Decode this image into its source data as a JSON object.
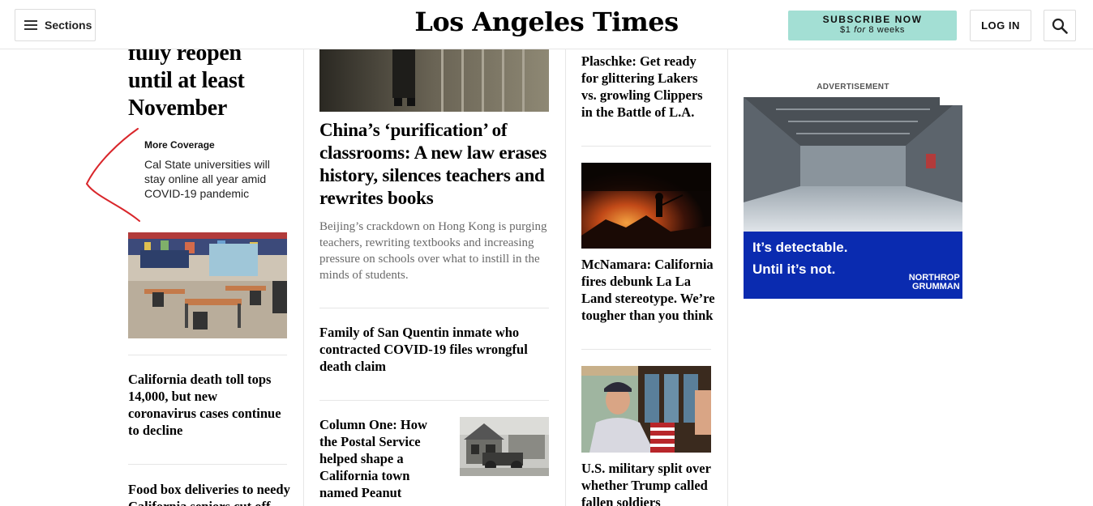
{
  "header": {
    "sections_label": "Sections",
    "logo": "Los Angeles Times",
    "subscribe_title": "SUBSCRIBE NOW",
    "subscribe_price": "$1",
    "subscribe_for": "for",
    "subscribe_period": "8 weeks",
    "login_label": "LOG IN"
  },
  "left_column": {
    "top_headline": [
      "fully reopen",
      "until at least",
      "November"
    ],
    "more_coverage_label": "More Coverage",
    "more_coverage_link": "Cal State universities will stay online all year amid COVID-19 pandemic",
    "story2_headline": "California death toll tops 14,000, but new coronavirus cases continue to decline",
    "story3_headline": "Food box deliveries to needy California seniors cut off"
  },
  "center_column": {
    "main_headline": "China’s ‘purification’ of classrooms: A new law erases history, silences teachers and rewrites books",
    "main_description": "Beijing’s crackdown on Hong Kong is purging teachers, rewriting textbooks and increasing pressure on schools over what to instill in the minds of students.",
    "story2_headline": "Family of San Quentin inmate who contracted COVID-19 files wrongful death claim",
    "story3_headline": "Column One: How the Postal Service helped shape a California town named Peanut"
  },
  "right_column": {
    "story1_headline": "Plaschke: Get ready for glittering Lakers vs. growling Clippers in the Battle of L.A.",
    "story2_headline": "McNamara: California fires debunk La La Land stereotype. We’re tougher than you think",
    "story3_headline": "U.S. military split over whether Trump called fallen soldiers ‘suckers’"
  },
  "advertisement": {
    "label": "ADVERTISEMENT",
    "line1": "It’s detectable.",
    "line2": "Until it’s not.",
    "brand_line1": "NORTHROP",
    "brand_line2": "GRUMMAN"
  },
  "colors": {
    "subscribe_bg": "#a3dfd4",
    "ad_blue": "#0a2bb0",
    "annotation_red": "#d9262b"
  }
}
